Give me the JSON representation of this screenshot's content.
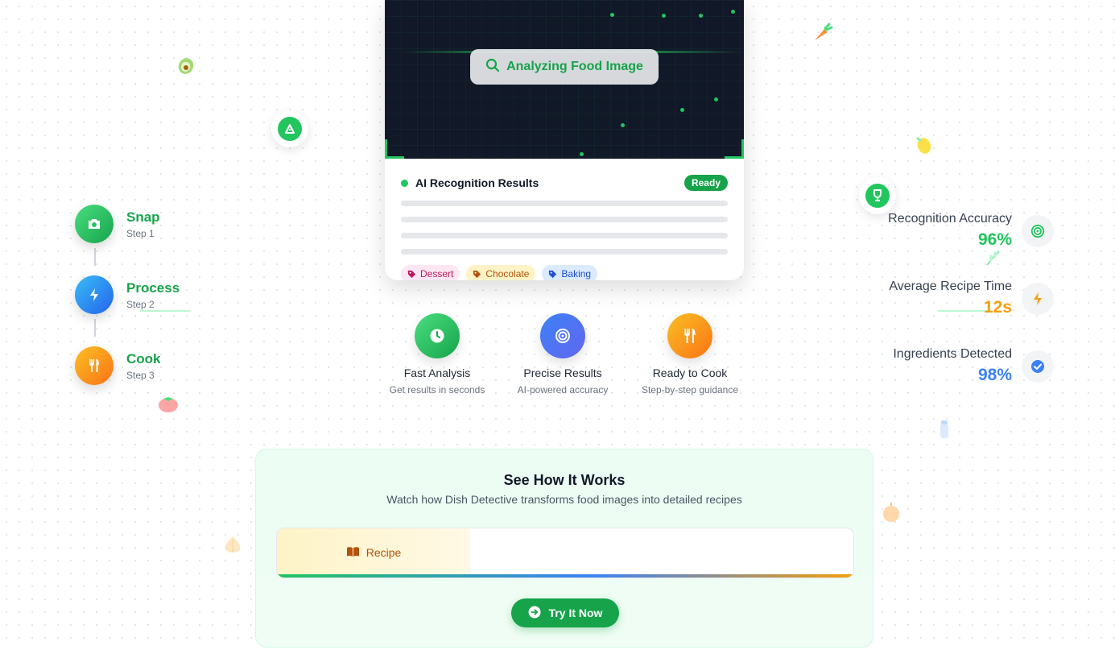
{
  "scanner": {
    "analyze_label": "Analyzing Food Image",
    "results_title": "AI Recognition Results",
    "status_badge": "Ready",
    "tags": [
      "Dessert",
      "Chocolate",
      "Baking"
    ]
  },
  "steps": [
    {
      "label": "Snap",
      "sub": "Step 1",
      "icon": "camera-icon"
    },
    {
      "label": "Process",
      "sub": "Step 2",
      "icon": "bolt-icon"
    },
    {
      "label": "Cook",
      "sub": "Step 3",
      "icon": "utensils-icon"
    }
  ],
  "features": [
    {
      "title": "Fast Analysis",
      "sub": "Get results in seconds",
      "icon": "clock-icon",
      "color": "#22c55e"
    },
    {
      "title": "Precise Results",
      "sub": "AI-powered accuracy",
      "icon": "target-icon",
      "color": "#3b82f6"
    },
    {
      "title": "Ready to Cook",
      "sub": "Step-by-step guidance",
      "icon": "utensils-icon",
      "color": "#f59e0b"
    }
  ],
  "stats": [
    {
      "label": "Recognition Accuracy",
      "value": "96%",
      "color": "#22c55e",
      "icon": "target-icon"
    },
    {
      "label": "Average Recipe Time",
      "value": "12s",
      "color": "#f59e0b",
      "icon": "bolt-icon"
    },
    {
      "label": "Ingredients Detected",
      "value": "98%",
      "color": "#3b82f6",
      "icon": "check-circle-icon"
    }
  ],
  "how": {
    "title": "See How It Works",
    "subtitle": "Watch how Dish Detective transforms food images into detailed recipes",
    "active_tab": "Recipe",
    "cta": "Try It Now"
  },
  "decorations": [
    "avocado-icon",
    "carrot-icon",
    "pizza-icon",
    "lemon-icon",
    "wine-glass-icon",
    "herb-icon",
    "tomato-icon",
    "salt-shaker-icon",
    "onion-icon",
    "garlic-icon"
  ]
}
